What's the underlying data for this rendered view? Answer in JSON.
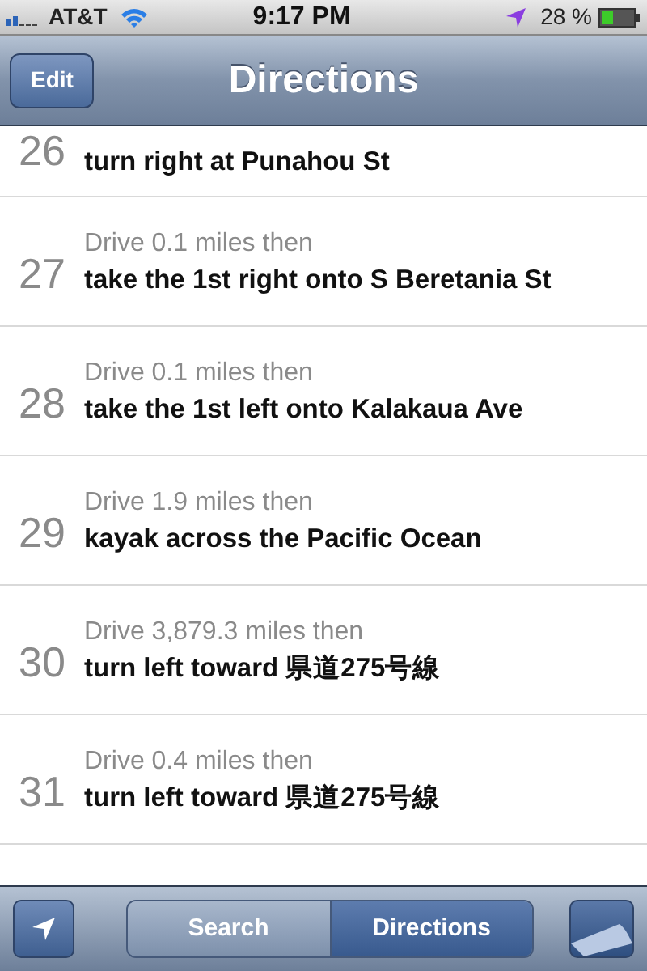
{
  "status_bar": {
    "carrier": "AT&T",
    "time": "9:17 PM",
    "battery": "28 %"
  },
  "nav_bar": {
    "edit_button": "Edit",
    "title": "Directions"
  },
  "steps": [
    {
      "number": "26",
      "instruction": "turn right at Punahou St"
    },
    {
      "number": "27",
      "distance": "Drive 0.1 miles then",
      "instruction": "take the 1st right onto S Beretania St"
    },
    {
      "number": "28",
      "distance": "Drive 0.1 miles then",
      "instruction": "take the 1st left onto Kalakaua Ave"
    },
    {
      "number": "29",
      "distance": "Drive 1.9 miles then",
      "instruction": "kayak across the Pacific Ocean"
    },
    {
      "number": "30",
      "distance": "Drive 3,879.3 miles then",
      "instruction": "turn left toward 県道275号線"
    },
    {
      "number": "31",
      "distance": "Drive 0.4 miles then",
      "instruction": "turn left toward 県道275号線"
    }
  ],
  "toolbar": {
    "segments": [
      {
        "label": "Search",
        "selected": false
      },
      {
        "label": "Directions",
        "selected": true
      }
    ]
  }
}
